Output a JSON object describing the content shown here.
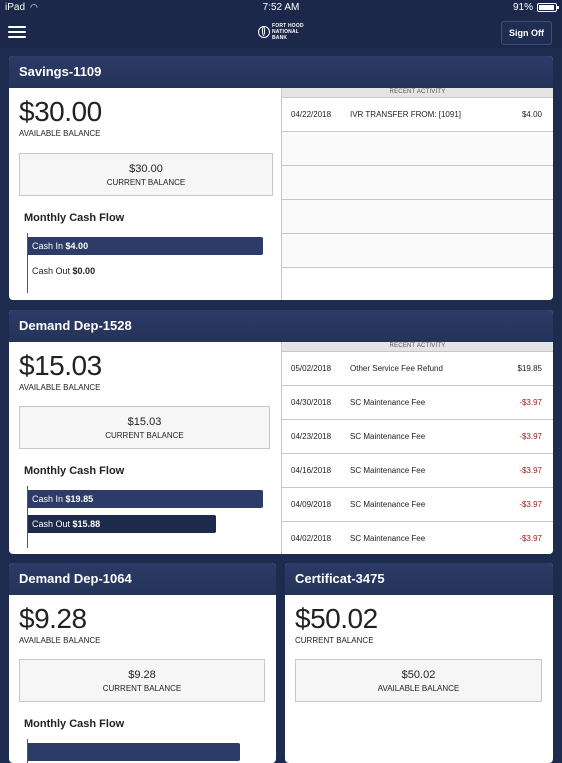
{
  "status_bar": {
    "device": "iPad",
    "time": "7:52 AM",
    "battery": "91%",
    "battery_level": 0.91
  },
  "nav": {
    "sign_off": "Sign Off"
  },
  "accounts": [
    {
      "name": "Savings-1109",
      "available_balance": "$30.00",
      "available_label": "AVAILABLE BALANCE",
      "current_balance": "$30.00",
      "current_label": "CURRENT BALANCE",
      "cash_flow_title": "Monthly Cash Flow",
      "cash_in_label": "Cash In",
      "cash_in": "$4.00",
      "cash_in_value": 4.0,
      "cash_out_label": "Cash Out",
      "cash_out": "$0.00",
      "cash_out_value": 0.0,
      "activity_header": "RECENT ACTIVITY",
      "activity": [
        {
          "date": "04/22/2018",
          "description": "IVR TRANSFER FROM: [1091]",
          "amount": "$4.00"
        }
      ]
    },
    {
      "name": "Demand Dep-1528",
      "available_balance": "$15.03",
      "available_label": "AVAILABLE BALANCE",
      "current_balance": "$15.03",
      "current_label": "CURRENT BALANCE",
      "cash_flow_title": "Monthly Cash Flow",
      "cash_in_label": "Cash In",
      "cash_in": "$19.85",
      "cash_in_value": 19.85,
      "cash_out_label": "Cash Out",
      "cash_out": "$15.88",
      "cash_out_value": 15.88,
      "activity_header": "RECENT ACTIVITY",
      "activity": [
        {
          "date": "05/02/2018",
          "description": "Other Service Fee Refund",
          "amount": "$19.85"
        },
        {
          "date": "04/30/2018",
          "description": "SC Maintenance Fee",
          "amount": "-$3.97"
        },
        {
          "date": "04/23/2018",
          "description": "SC Maintenance Fee",
          "amount": "-$3.97"
        },
        {
          "date": "04/16/2018",
          "description": "SC Maintenance Fee",
          "amount": "-$3.97"
        },
        {
          "date": "04/09/2018",
          "description": "SC Maintenance Fee",
          "amount": "-$3.97"
        },
        {
          "date": "04/02/2018",
          "description": "SC Maintenance Fee",
          "amount": "-$3.97"
        }
      ]
    },
    {
      "name": "Demand Dep-1064",
      "available_balance": "$9.28",
      "available_label": "AVAILABLE BALANCE",
      "current_balance": "$9.28",
      "current_label": "CURRENT BALANCE",
      "cash_flow_title": "Monthly Cash Flow"
    },
    {
      "name": "Certificat-3475",
      "current_balance": "$50.02",
      "current_label": "CURRENT BALANCE",
      "available_balance": "$50.02",
      "available_label": "AVAILABLE BALANCE"
    }
  ],
  "colors": {
    "header_bg": "#1b2849",
    "card_header": "#2c3b67",
    "negative": "#a02020"
  }
}
